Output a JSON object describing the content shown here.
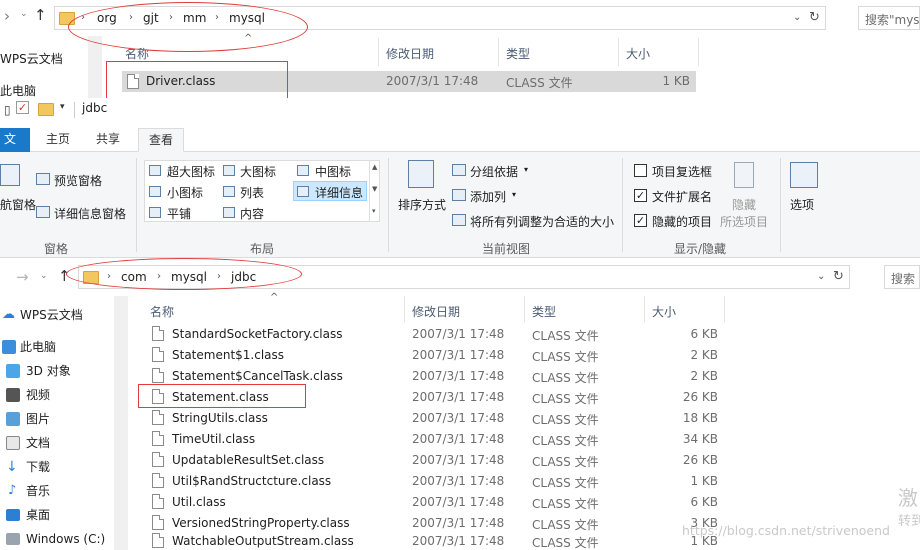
{
  "top_window": {
    "breadcrumb": [
      "org",
      "gjt",
      "mm",
      "mysql"
    ],
    "search_placeholder": "搜索\"mys",
    "nav_item": "WPS云文档",
    "nav_item2": "此电脑",
    "columns": {
      "name": "名称",
      "date": "修改日期",
      "type": "类型",
      "size": "大小"
    },
    "file": {
      "name": "Driver.class",
      "date": "2007/3/1 17:48",
      "type": "CLASS 文件",
      "size": "1 KB"
    }
  },
  "window2": {
    "title": "jdbc"
  },
  "ribbon": {
    "tabs": {
      "file": "文件",
      "home": "主页",
      "share": "共享",
      "view": "查看"
    },
    "pane_group": {
      "preview": "预览窗格",
      "details": "详细信息窗格",
      "nav": "航窗格",
      "label": "窗格"
    },
    "layout": {
      "items": [
        "超大图标",
        "大图标",
        "中图标",
        "小图标",
        "列表",
        "详细信息",
        "平铺",
        "内容"
      ],
      "label": "布局"
    },
    "current_view": {
      "sort": "排序方式",
      "group": "分组依据",
      "add_col": "添加列",
      "fit_cols": "将所有列调整为合适的大小",
      "label": "当前视图"
    },
    "show_hide": {
      "item_checkbox": "项目复选框",
      "ext": "文件扩展名",
      "hidden": "隐藏的项目",
      "hide": "隐藏",
      "hide_sel": "所选项目",
      "label": "显示/隐藏"
    },
    "options": "选项"
  },
  "bottom_window": {
    "breadcrumb": [
      "com",
      "mysql",
      "jdbc"
    ],
    "search_placeholder": "搜索",
    "nav": [
      "WPS云文档",
      "此电脑",
      "3D 对象",
      "视频",
      "图片",
      "文档",
      "下载",
      "音乐",
      "桌面",
      "Windows (C:)"
    ],
    "columns": {
      "name": "名称",
      "date": "修改日期",
      "type": "类型",
      "size": "大小"
    },
    "files": [
      {
        "name": "StandardSocketFactory.class",
        "date": "2007/3/1 17:48",
        "type": "CLASS 文件",
        "size": "6 KB"
      },
      {
        "name": "Statement$1.class",
        "date": "2007/3/1 17:48",
        "type": "CLASS 文件",
        "size": "2 KB"
      },
      {
        "name": "Statement$CancelTask.class",
        "date": "2007/3/1 17:48",
        "type": "CLASS 文件",
        "size": "2 KB"
      },
      {
        "name": "Statement.class",
        "date": "2007/3/1 17:48",
        "type": "CLASS 文件",
        "size": "26 KB"
      },
      {
        "name": "StringUtils.class",
        "date": "2007/3/1 17:48",
        "type": "CLASS 文件",
        "size": "18 KB"
      },
      {
        "name": "TimeUtil.class",
        "date": "2007/3/1 17:48",
        "type": "CLASS 文件",
        "size": "34 KB"
      },
      {
        "name": "UpdatableResultSet.class",
        "date": "2007/3/1 17:48",
        "type": "CLASS 文件",
        "size": "26 KB"
      },
      {
        "name": "Util$RandStructcture.class",
        "date": "2007/3/1 17:48",
        "type": "CLASS 文件",
        "size": "1 KB"
      },
      {
        "name": "Util.class",
        "date": "2007/3/1 17:48",
        "type": "CLASS 文件",
        "size": "6 KB"
      },
      {
        "name": "VersionedStringProperty.class",
        "date": "2007/3/1 17:48",
        "type": "CLASS 文件",
        "size": "3 KB"
      },
      {
        "name": "WatchableOutputStream.class",
        "date": "2007/3/1 17:48",
        "type": "CLASS 文件",
        "size": "1 KB"
      }
    ]
  },
  "watermark": {
    "line1": "激",
    "line2": "转到",
    "url": "https://blog.csdn.net/strivenoend"
  },
  "colors": {
    "accent": "#1979ca",
    "annotation": "#e23b3b",
    "folder": "#f3c75f"
  }
}
